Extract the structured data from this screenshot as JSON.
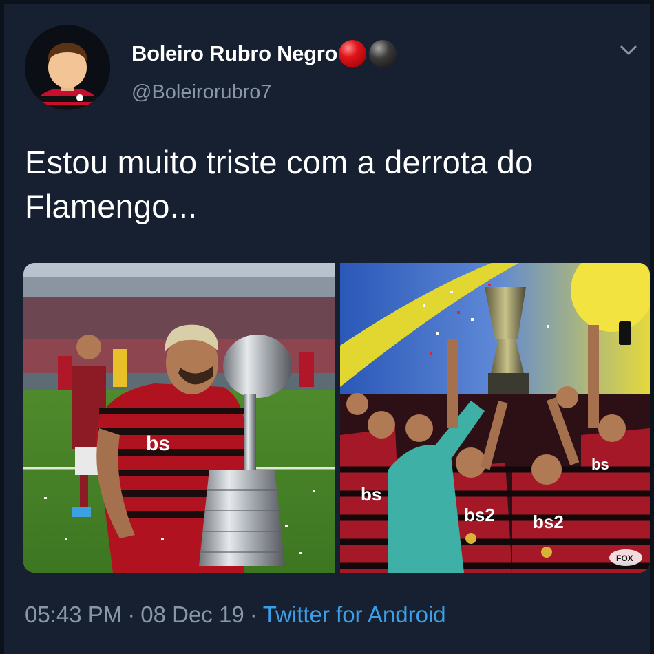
{
  "author": {
    "display_name": "Boleiro Rubro Negro",
    "handle": "@Boleirorubro7",
    "name_emojis": [
      "red-ball-emoji",
      "black-ball-emoji"
    ]
  },
  "tweet": {
    "text": "Estou muito triste com a derrota do Flamengo..."
  },
  "media": {
    "overlay_logo": "FOX"
  },
  "footer": {
    "time": "05:43 PM",
    "date": "08 Dec 19",
    "separator": "·",
    "source": "Twitter for Android"
  },
  "colors": {
    "background": "#162030",
    "text": "#ffffff",
    "secondary": "#8897a8",
    "link": "#3a9fe8",
    "flamengo_red": "#c8102e",
    "flamengo_black": "#111111"
  },
  "icons": {
    "menu": "chevron-down-icon"
  }
}
